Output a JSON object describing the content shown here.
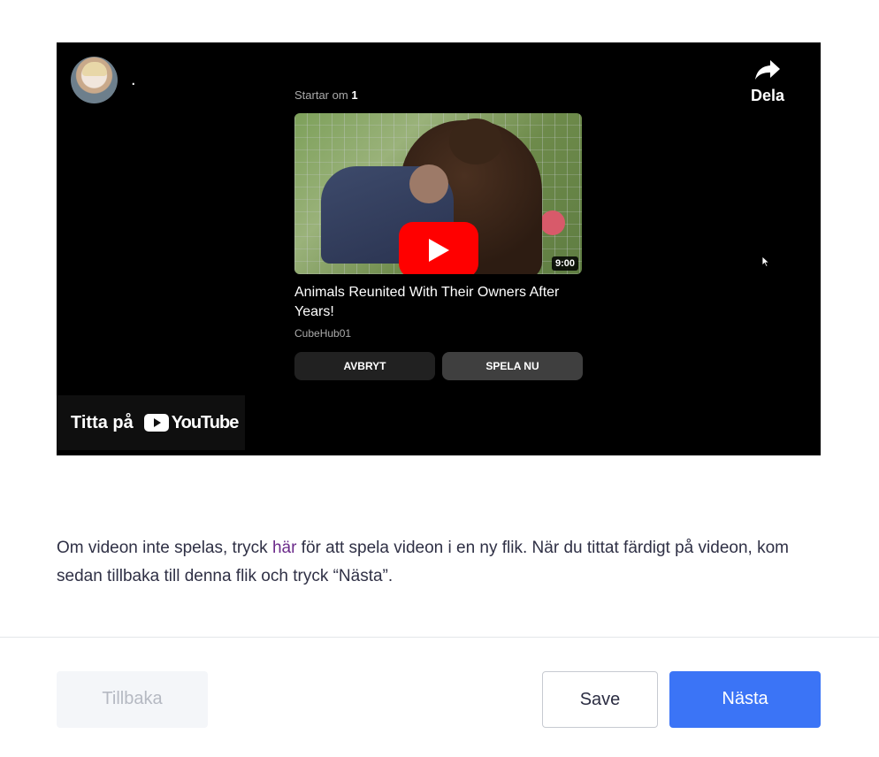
{
  "video": {
    "channel_text": ".",
    "share_label": "Dela",
    "upnext_prefix": "Startar om",
    "upnext_count": "1",
    "title": "Animals Reunited With Their Owners After Years!",
    "channel": "CubeHub01",
    "duration": "9:00",
    "cancel_label": "AVBRYT",
    "play_now_label": "SPELA NU",
    "watch_on_label": "Titta på",
    "youtube_word": "YouTube"
  },
  "instructions": {
    "before_link": "Om videon inte spelas, tryck ",
    "link_text": "här",
    "after_link": " för att spela videon i en ny flik. När du tittat färdigt på videon, kom sedan tillbaka till denna flik och tryck “Nästa”."
  },
  "footer": {
    "back_label": "Tillbaka",
    "save_label": "Save",
    "next_label": "Nästa"
  },
  "colors": {
    "next_button": "#3b74f6",
    "youtube_red": "#ff0000",
    "link": "#6b2a8a"
  },
  "icons": [
    "share-icon",
    "play-icon",
    "youtube-logo-icon",
    "cursor-icon"
  ]
}
